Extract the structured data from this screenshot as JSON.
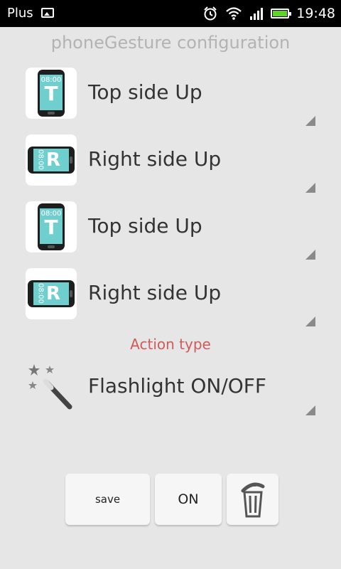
{
  "status_bar": {
    "carrier": "Plus",
    "time": "19:48",
    "icons": [
      "image-icon",
      "alarm-icon",
      "wifi-icon",
      "signal-icon",
      "battery-icon"
    ],
    "battery_color": "#5fd428",
    "battery_level": 0.9
  },
  "title": "phoneGesture configuration",
  "gestures": [
    {
      "label": "Top side Up",
      "icon": "phone-top-icon",
      "clock": "08:00",
      "letter": "T"
    },
    {
      "label": "Right side Up",
      "icon": "phone-right-icon",
      "clock": "08:00",
      "letter": "R"
    },
    {
      "label": "Top side Up",
      "icon": "phone-top-icon",
      "clock": "08:00",
      "letter": "T"
    },
    {
      "label": "Right side Up",
      "icon": "phone-right-icon",
      "clock": "08:00",
      "letter": "R"
    }
  ],
  "action": {
    "heading": "Action type",
    "heading_color": "#d05a5a",
    "label": "Flashlight ON/OFF",
    "icon": "magic-wand-icon"
  },
  "buttons": {
    "save_label": "save",
    "toggle_label": "ON",
    "delete_icon": "trash-icon"
  },
  "colors": {
    "screen": "#6fcfcf",
    "background": "#e6e6e6"
  }
}
